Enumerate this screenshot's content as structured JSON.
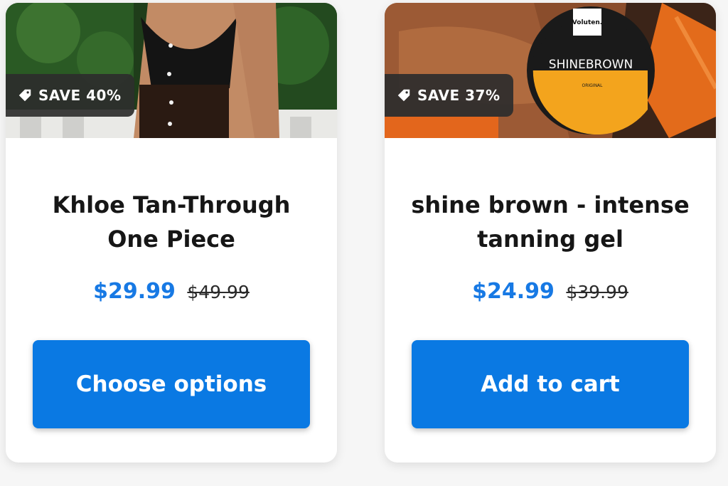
{
  "products": [
    {
      "badge": "SAVE 40%",
      "title": "Khloe Tan-Through One Piece",
      "price_now": "$29.99",
      "price_was": "$49.99",
      "cta_label": "Choose options"
    },
    {
      "badge": "SAVE 37%",
      "title": "shine brown - intense tanning gel",
      "price_now": "$24.99",
      "price_was": "$39.99",
      "cta_label": "Add to cart",
      "image_text": {
        "brand": "Voluten.",
        "product": "SHINEBROWN",
        "variant": "ORIGINAL"
      }
    }
  ],
  "colors": {
    "accent": "#1779e4",
    "cta": "#0a79e3",
    "badge_bg": "#2d2d2d"
  },
  "icons": {
    "badge_icon": "tag-icon"
  }
}
